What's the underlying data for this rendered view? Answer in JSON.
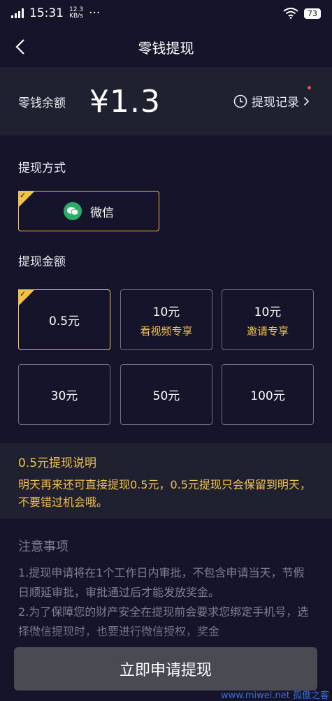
{
  "status_bar": {
    "time": "15:31",
    "speed_value": "12.3",
    "speed_unit": "KB/s",
    "dots": "···",
    "battery": "73"
  },
  "nav": {
    "title": "零钱提现"
  },
  "balance": {
    "label": "零钱余额",
    "amount": "¥1.3",
    "history_label": "提现记录"
  },
  "method": {
    "label": "提现方式",
    "options": [
      {
        "label": "微信",
        "selected": true
      }
    ]
  },
  "amount_section": {
    "label": "提现金额",
    "options": [
      {
        "label": "0.5元",
        "sub": "",
        "selected": true
      },
      {
        "label": "10元",
        "sub": "看视频专享",
        "selected": false
      },
      {
        "label": "10元",
        "sub": "邀请专享",
        "selected": false
      },
      {
        "label": "30元",
        "sub": "",
        "selected": false
      },
      {
        "label": "50元",
        "sub": "",
        "selected": false
      },
      {
        "label": "100元",
        "sub": "",
        "selected": false
      }
    ]
  },
  "notice": {
    "title": "0.5元提现说明",
    "text": "明天再来还可直接提现0.5元，0.5元提现只会保留到明天，不要错过机会哦。"
  },
  "notes": {
    "title": "注意事项",
    "items": [
      "1.提现申请将在1个工作日内审批，不包含申请当天，节假日顺延审批，审批通过后才能发放奖金。",
      "2.为了保障您的财产安全在提现前会要求您绑定手机号，选择微信提现时，也要进行微信授权，奖金"
    ]
  },
  "apply_button": {
    "label": "立即申请提现"
  },
  "watermark": "www.miwei.net 孤傲之客",
  "colors": {
    "accent": "#f2c14a",
    "background": "#16142a",
    "card": "#1f2030",
    "button": "#4a4a52",
    "wechat": "#2aae67"
  },
  "icons": {
    "back": "chevron-left-icon",
    "history": "clock-icon",
    "history_arrow": "chevron-right-icon",
    "wechat": "wechat-icon",
    "selected": "check-icon"
  }
}
